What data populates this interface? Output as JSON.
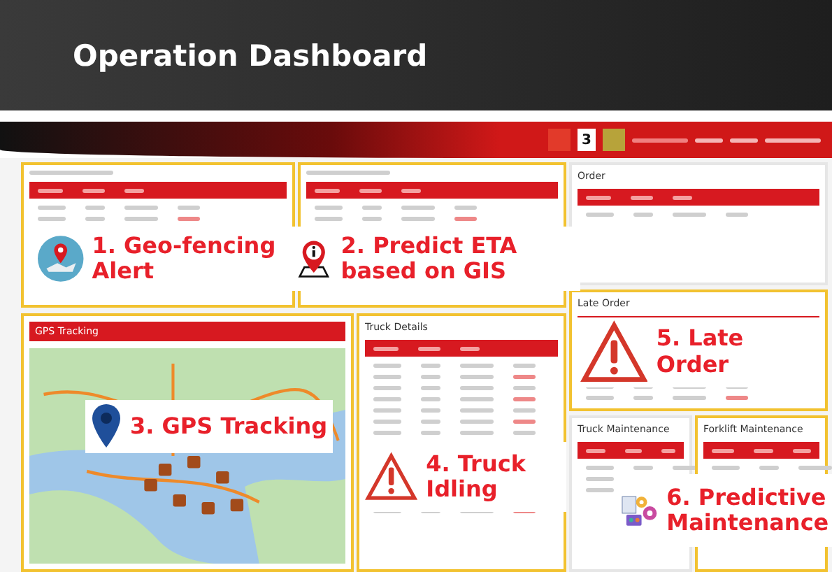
{
  "slide_title": "Operation Dashboard",
  "header": {
    "notification_count": "3"
  },
  "panels": [
    {
      "kind": "table",
      "callout": "1. Geo-fencing Alert"
    },
    {
      "kind": "table",
      "callout": "2. Predict ETA based on GIS"
    },
    {
      "kind": "map",
      "title": "GPS Tracking",
      "callout": "3. GPS Tracking"
    },
    {
      "kind": "table",
      "title": "Truck Details",
      "callout": "4. Truck Idling"
    },
    {
      "kind": "table",
      "title": "Order"
    },
    {
      "kind": "table",
      "title": "Late Order",
      "callout": "5. Late Order"
    },
    {
      "kind": "table",
      "title": "Truck Maintenance"
    },
    {
      "kind": "table",
      "title": "Forklift Maintenance",
      "callout": "6. Predictive Maintenance"
    }
  ]
}
